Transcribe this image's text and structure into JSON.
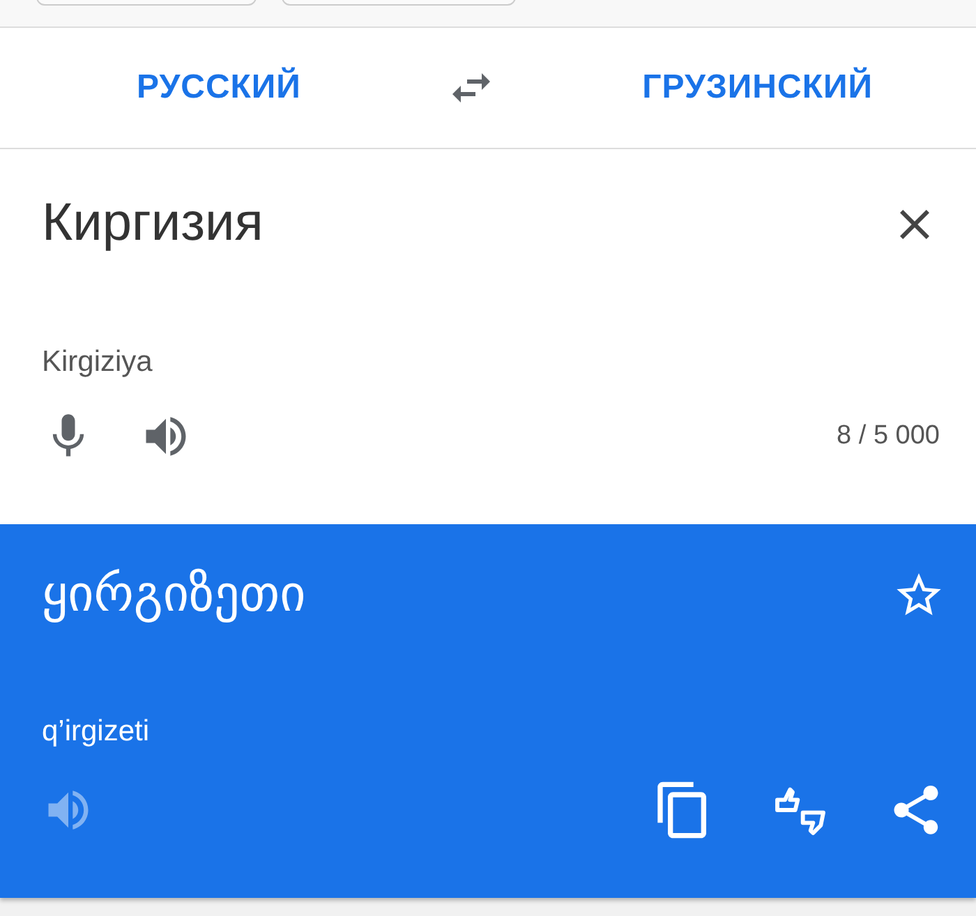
{
  "languages": {
    "source": "РУССКИЙ",
    "target": "ГРУЗИНСКИЙ"
  },
  "input": {
    "text": "Киргизия",
    "transliteration": "Kirgiziya",
    "counter": "8 / 5 000"
  },
  "result": {
    "text": "ყირგიზეთი",
    "transliteration": "q’irgizeti",
    "starred": false,
    "speaker_disabled": true
  }
}
